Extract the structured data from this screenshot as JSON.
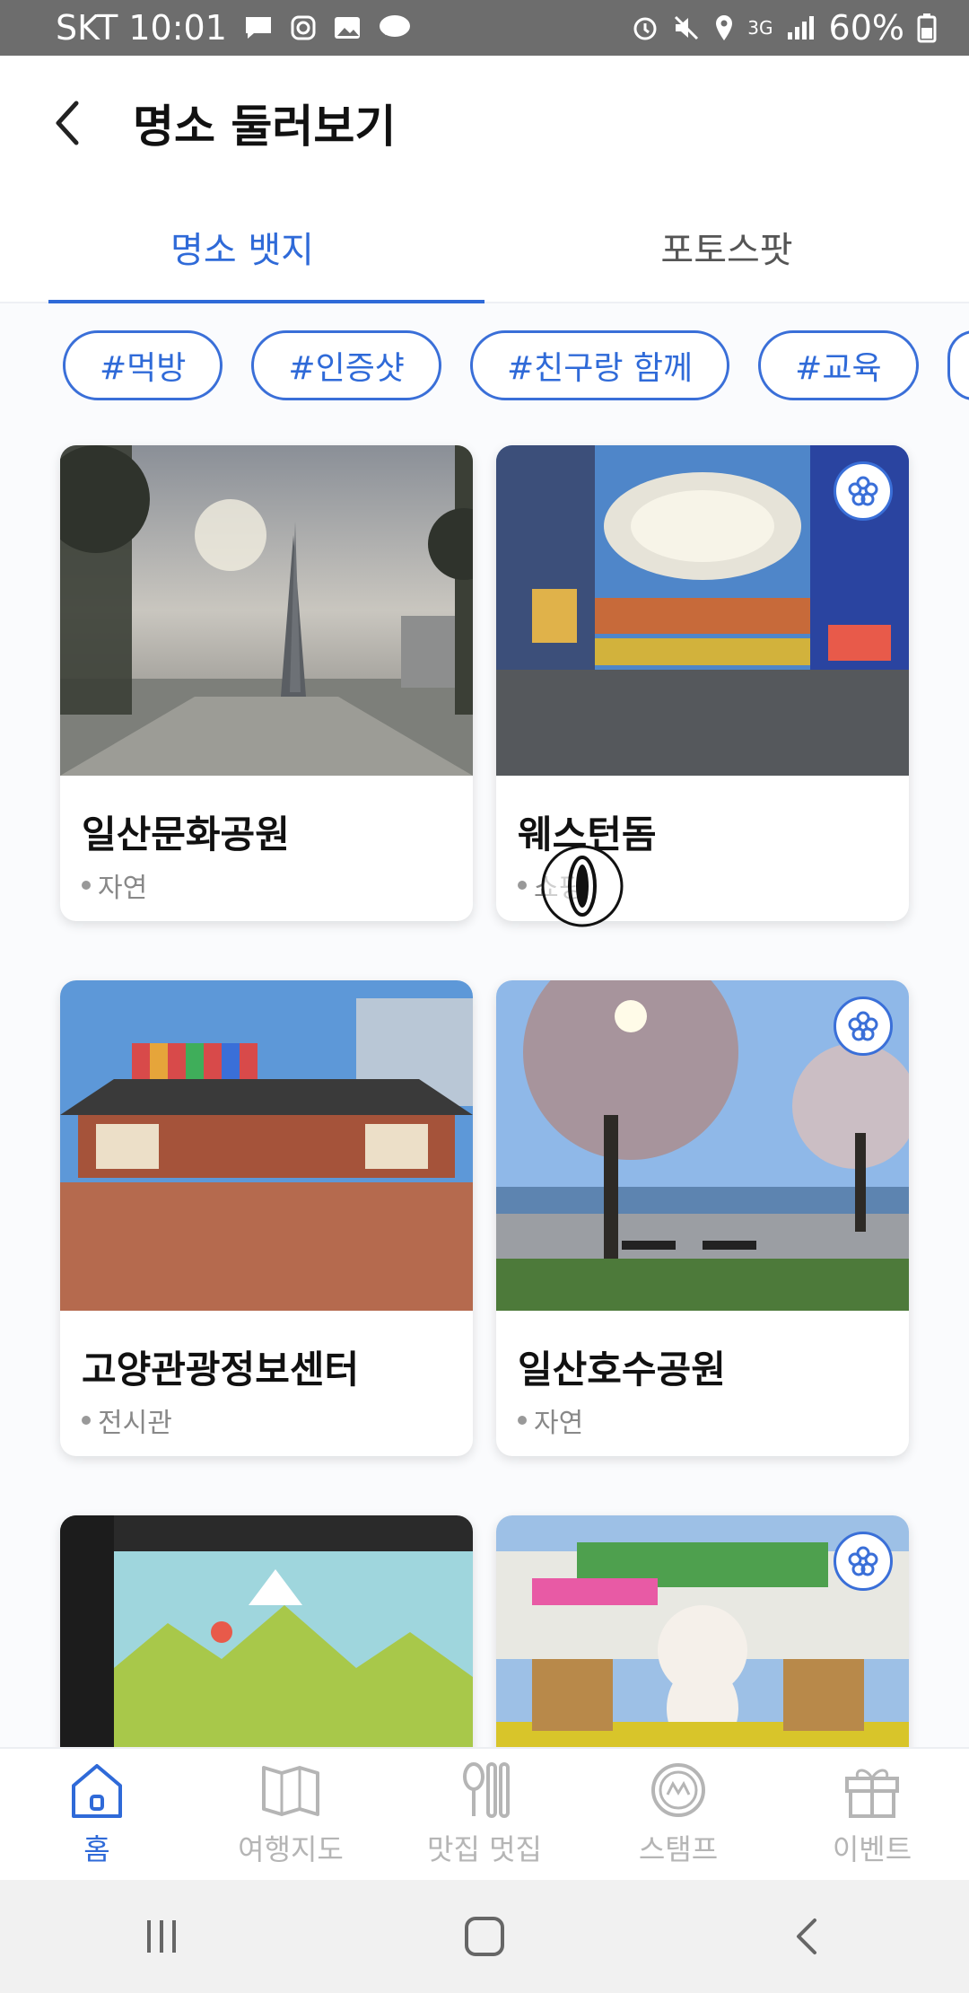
{
  "status_bar": {
    "carrier_time": "SKT 10:01",
    "network": "3G",
    "battery": "60%"
  },
  "header": {
    "title": "명소 둘러보기"
  },
  "tabs": [
    {
      "label": "명소 뱃지",
      "active": true
    },
    {
      "label": "포토스팟",
      "active": false
    }
  ],
  "chips": [
    "#먹방",
    "#인증샷",
    "#친구랑 함께",
    "#교육"
  ],
  "cards": [
    {
      "name": "일산문화공원",
      "category": "자연",
      "badge": false
    },
    {
      "name": "웨스턴돔",
      "category": "쇼핑",
      "badge": true
    },
    {
      "name": "고양관광정보센터",
      "category": "전시관",
      "badge": false
    },
    {
      "name": "일산호수공원",
      "category": "자연",
      "badge": true
    },
    {
      "name": "",
      "category": "",
      "badge": false
    },
    {
      "name": "",
      "category": "",
      "badge": true
    }
  ],
  "bottom_nav": [
    {
      "label": "홈",
      "icon": "home-icon",
      "active": true
    },
    {
      "label": "여행지도",
      "icon": "map-icon",
      "active": false
    },
    {
      "label": "맛집 멋집",
      "icon": "food-icon",
      "active": false
    },
    {
      "label": "스탬프",
      "icon": "stamp-icon",
      "active": false
    },
    {
      "label": "이벤트",
      "icon": "gift-icon",
      "active": false
    }
  ],
  "colors": {
    "accent": "#2f6ad8",
    "status_bar": "#6d6d6d",
    "inactive": "#b5b5b5"
  }
}
